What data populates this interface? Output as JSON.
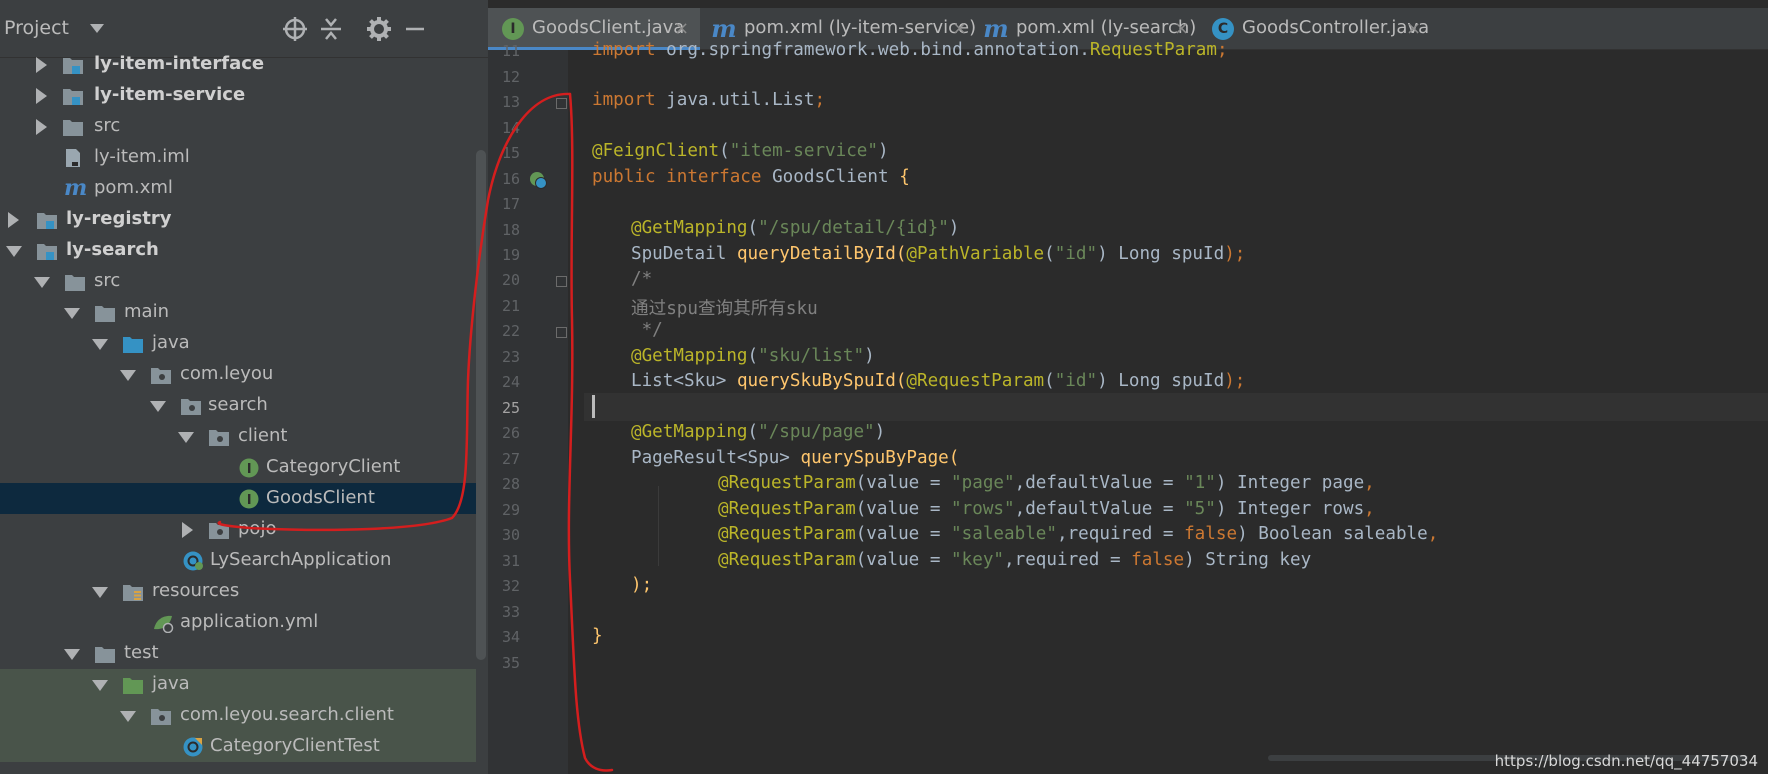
{
  "project_panel": {
    "title": "Project",
    "tree": [
      {
        "label": "ly-item-interface",
        "bold": true
      },
      {
        "label": "ly-item-service",
        "bold": true
      },
      {
        "label": "src",
        "bold": false
      },
      {
        "label": "ly-item.iml",
        "bold": false
      },
      {
        "label": "pom.xml",
        "bold": false
      },
      {
        "label": "ly-registry",
        "bold": true
      },
      {
        "label": "ly-search",
        "bold": true
      },
      {
        "label": "src",
        "bold": false
      },
      {
        "label": "main",
        "bold": false
      },
      {
        "label": "java",
        "bold": false
      },
      {
        "label": "com.leyou",
        "bold": false
      },
      {
        "label": "search",
        "bold": false
      },
      {
        "label": "client",
        "bold": false
      },
      {
        "label": "CategoryClient",
        "bold": false
      },
      {
        "label": "GoodsClient",
        "bold": false
      },
      {
        "label": "pojo",
        "bold": false
      },
      {
        "label": "LySearchApplication",
        "bold": false
      },
      {
        "label": "resources",
        "bold": false
      },
      {
        "label": "application.yml",
        "bold": false
      },
      {
        "label": "test",
        "bold": false
      },
      {
        "label": "java",
        "bold": false
      },
      {
        "label": "com.leyou.search.client",
        "bold": false
      },
      {
        "label": "CategoryClientTest",
        "bold": false
      }
    ]
  },
  "tabs": [
    {
      "label": "GoodsClient.java",
      "icon": "interface-icon",
      "active": true
    },
    {
      "label": "pom.xml (ly-item-service)",
      "icon": "maven-icon",
      "active": false
    },
    {
      "label": "pom.xml (ly-search)",
      "icon": "maven-icon",
      "active": false
    },
    {
      "label": "GoodsController.java",
      "icon": "class-icon",
      "active": false
    }
  ],
  "tab_icon_letters": {
    "interface": "I",
    "class": "C",
    "maven": "m"
  },
  "line_numbers": [
    "11",
    "12",
    "13",
    "14",
    "15",
    "16",
    "17",
    "18",
    "19",
    "20",
    "21",
    "22",
    "23",
    "24",
    "25",
    "26",
    "27",
    "28",
    "29",
    "30",
    "31",
    "32",
    "33",
    "34",
    "35"
  ],
  "code": {
    "l11": {
      "kw": "import ",
      "rest": "org.springframework.web.bind.annotation.",
      "cls": "RequestParam",
      "end": ";"
    },
    "l13": {
      "kw": "import ",
      "rest": "java.util.List",
      "end": ";"
    },
    "l15": {
      "ann": "@FeignClient",
      "open": "(",
      "str": "\"item-service\"",
      "close": ")"
    },
    "l16": {
      "kw1": "public ",
      "kw2": "interface ",
      "name": "GoodsClient ",
      "brace": "{"
    },
    "l18": {
      "ann": "@GetMapping",
      "open": "(",
      "str": "\"/spu/detail/{id}\"",
      "close": ")"
    },
    "l19": {
      "type": "SpuDetail ",
      "fn": "queryDetailById",
      "open": "(",
      "ann": "@PathVariable",
      "p1": "(",
      "str": "\"id\"",
      "p2": ") Long spuId",
      "end": ");"
    },
    "l20": {
      "cm": "/*"
    },
    "l21": {
      "cm": "通过spu查询其所有sku"
    },
    "l22": {
      "cm": " */"
    },
    "l23": {
      "ann": "@GetMapping",
      "open": "(",
      "str": "\"sku/list\"",
      "close": ")"
    },
    "l24": {
      "type": "List<Sku> ",
      "fn": "querySkuBySpuId",
      "open": "(",
      "ann": "@RequestParam",
      "p1": "(",
      "str": "\"id\"",
      "p2": ") Long spuId",
      "end": ");"
    },
    "l26": {
      "ann": "@GetMapping",
      "open": "(",
      "str": "\"/spu/page\"",
      "close": ")"
    },
    "l27": {
      "type": "PageResult<Spu> ",
      "fn": "querySpuByPage",
      "open": "("
    },
    "l28": {
      "ann": "@RequestParam",
      "a": "(value = ",
      "s1": "\"page\"",
      "b": ",defaultValue = ",
      "s2": "\"1\"",
      "c": ") Integer page",
      "end": ","
    },
    "l29": {
      "ann": "@RequestParam",
      "a": "(value = ",
      "s1": "\"rows\"",
      "b": ",defaultValue = ",
      "s2": "\"5\"",
      "c": ") Integer rows",
      "end": ","
    },
    "l30": {
      "ann": "@RequestParam",
      "a": "(value = ",
      "s1": "\"saleable\"",
      "b": ",required = ",
      "k": "false",
      "c": ") Boolean saleable",
      "end": ","
    },
    "l31": {
      "ann": "@RequestParam",
      "a": "(value = ",
      "s1": "\"key\"",
      "b": ",required = ",
      "k": "false",
      "c": ") String key"
    },
    "l32": {
      "end": ");"
    },
    "l34": {
      "brace": "}"
    }
  },
  "watermark": "https://blog.csdn.net/qq_44757034",
  "colors": {
    "keyword": "#cc7832",
    "annotation": "#bbb529",
    "string": "#6a8759",
    "method": "#ffc66d",
    "comment": "#808080",
    "annotation_stroke": "#d41e1e"
  }
}
